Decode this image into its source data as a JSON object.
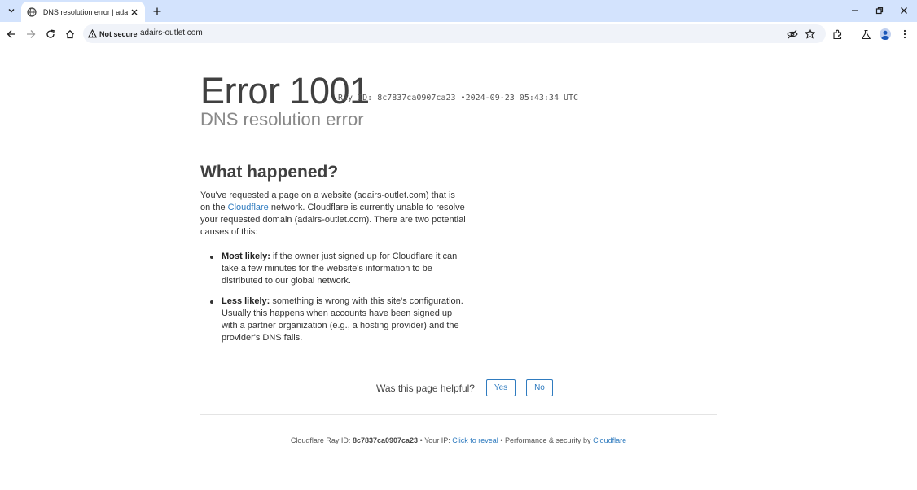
{
  "browser": {
    "tab_title": "DNS resolution error | adairs-outlet.com",
    "security_label": "Not secure",
    "url": "adairs-outlet.com"
  },
  "page": {
    "error_code": "Error 1001",
    "ray_prefix": "Ray ID:",
    "ray_id": "8c7837ca0907ca23",
    "bullet": "•",
    "timestamp": "2024-09-23 05:43:34 UTC",
    "error_title": "DNS resolution error",
    "what_heading": "What happened?",
    "para_1": "You've requested a page on a website (adairs-outlet.com) that is on the",
    "para_link": "Cloudflare",
    "para_2": "network. Cloudflare is currently unable to resolve your requested domain (adairs-outlet.com). There are two potential causes of this:",
    "causes": [
      {
        "label": "Most likely:",
        "text": "if the owner just signed up for Cloudflare it can take a few minutes for the website's information to be distributed to our global network."
      },
      {
        "label": "Less likely:",
        "text": "something is wrong with this site's configuration. Usually this happens when accounts have been signed up with a partner organization (e.g., a hosting provider) and the provider's DNS fails."
      }
    ],
    "feedback_question": "Was this page helpful?",
    "feedback_yes": "Yes",
    "feedback_no": "No"
  },
  "footer": {
    "ray_label": "Cloudflare Ray ID:",
    "ray_id": "8c7837ca0907ca23",
    "sep": "•",
    "ip_label": "Your IP:",
    "ip_link": "Click to reveal",
    "perf_label": "Performance & security by",
    "perf_link": "Cloudflare"
  },
  "colors": {
    "link": "#2f7bbf",
    "tabbar": "#d3e3fd"
  },
  "icons": [
    "tab-list-icon",
    "globe-icon",
    "close-icon",
    "plus-icon",
    "minimize-icon",
    "restore-icon",
    "window-close-icon",
    "back-icon",
    "forward-icon",
    "reload-icon",
    "home-icon",
    "warning-icon",
    "eye-off-icon",
    "star-icon",
    "extensions-icon",
    "labs-icon",
    "profile-icon",
    "menu-icon"
  ]
}
